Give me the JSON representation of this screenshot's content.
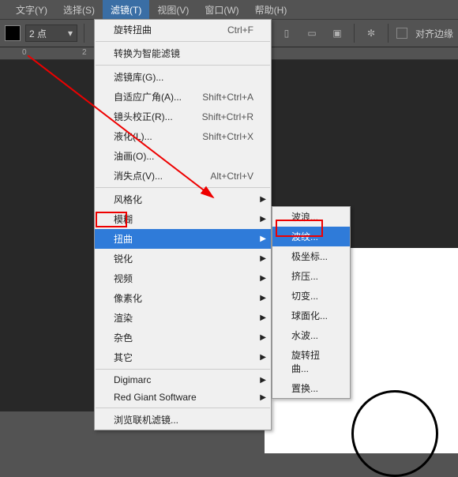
{
  "menubar": {
    "items": [
      {
        "label": "文字(Y)"
      },
      {
        "label": "选择(S)"
      },
      {
        "label": "滤镜(T)"
      },
      {
        "label": "视图(V)"
      },
      {
        "label": "窗口(W)"
      },
      {
        "label": "帮助(H)"
      }
    ]
  },
  "toolbar": {
    "stroke_value": "2 点",
    "align_label": "对齐边缘"
  },
  "ruler": {
    "marks": [
      "0",
      "2"
    ]
  },
  "filter_menu": {
    "last_filter": {
      "label": "旋转扭曲",
      "shortcut": "Ctrl+F"
    },
    "convert_smart": "转换为智能滤镜",
    "group1": [
      {
        "label": "滤镜库(G)...",
        "shortcut": ""
      },
      {
        "label": "自适应广角(A)...",
        "shortcut": "Shift+Ctrl+A"
      },
      {
        "label": "镜头校正(R)...",
        "shortcut": "Shift+Ctrl+R"
      },
      {
        "label": "液化(L)...",
        "shortcut": "Shift+Ctrl+X"
      },
      {
        "label": "油画(O)...",
        "shortcut": ""
      },
      {
        "label": "消失点(V)...",
        "shortcut": "Alt+Ctrl+V"
      }
    ],
    "group2": [
      {
        "label": "风格化"
      },
      {
        "label": "模糊"
      },
      {
        "label": "扭曲"
      },
      {
        "label": "锐化"
      },
      {
        "label": "视频"
      },
      {
        "label": "像素化"
      },
      {
        "label": "渲染"
      },
      {
        "label": "杂色"
      },
      {
        "label": "其它"
      }
    ],
    "group3": [
      {
        "label": "Digimarc"
      },
      {
        "label": "Red Giant Software"
      }
    ],
    "browse_online": "浏览联机滤镜..."
  },
  "distort_submenu": {
    "items": [
      {
        "label": "波浪..."
      },
      {
        "label": "波纹..."
      },
      {
        "label": "极坐标..."
      },
      {
        "label": "挤压..."
      },
      {
        "label": "切变..."
      },
      {
        "label": "球面化..."
      },
      {
        "label": "水波..."
      },
      {
        "label": "旋转扭曲..."
      },
      {
        "label": "置换..."
      }
    ]
  }
}
